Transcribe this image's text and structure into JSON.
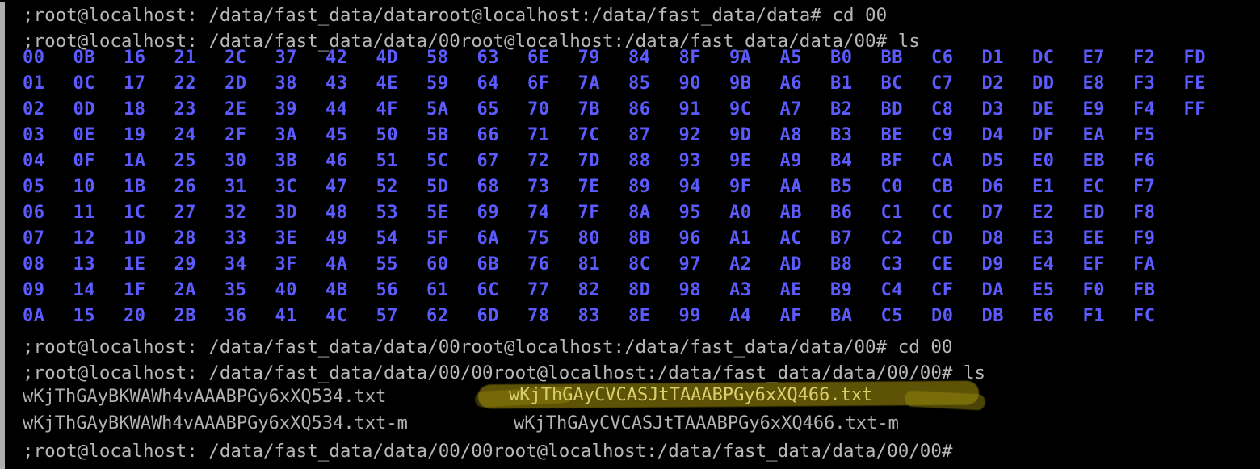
{
  "terminal": {
    "title": "root@localhost terminal",
    "colors": {
      "background": "#000000",
      "foreground": "#b2b2b2",
      "directory_blue": "#5b5bff",
      "highlight_olive": "#aa960a",
      "highlight_text": "#d9cf6e",
      "window_edge": "#aeaeae"
    },
    "lines": [
      {
        "id": "line-1",
        "type": "prompt",
        "text": ";root@localhost: /data/fast_data/dataroot@localhost:/data/fast_data/data# cd 00"
      },
      {
        "id": "line-2",
        "type": "prompt",
        "text": ";root@localhost: /data/fast_data/data/00root@localhost:/data/fast_data/data/00# ls"
      },
      {
        "id": "line-3",
        "type": "prompt",
        "text": ";root@localhost: /data/fast_data/data/00root@localhost:/data/fast_data/data/00# cd 00"
      },
      {
        "id": "line-4",
        "type": "prompt",
        "text": ";root@localhost: /data/fast_data/data/00/00root@localhost:/data/fast_data/data/00/00# ls"
      },
      {
        "id": "line-5",
        "type": "prompt",
        "text": ";root@localhost: /data/fast_data/data/00/00root@localhost:/data/fast_data/data/00/00#"
      }
    ],
    "hex_listing": {
      "description": "ls output of hex-named directories, column-major, 11 rows x 24 columns",
      "rows": 11,
      "columns": 24,
      "entries": [
        "00",
        "01",
        "02",
        "03",
        "04",
        "05",
        "06",
        "07",
        "08",
        "09",
        "0A",
        "0B",
        "0C",
        "0D",
        "0E",
        "0F",
        "10",
        "11",
        "12",
        "13",
        "14",
        "15",
        "16",
        "17",
        "18",
        "19",
        "1A",
        "1B",
        "1C",
        "1D",
        "1E",
        "1F",
        "20",
        "21",
        "22",
        "23",
        "24",
        "25",
        "26",
        "27",
        "28",
        "29",
        "2A",
        "2B",
        "2C",
        "2D",
        "2E",
        "2F",
        "30",
        "31",
        "32",
        "33",
        "34",
        "35",
        "36",
        "37",
        "38",
        "39",
        "3A",
        "3B",
        "3C",
        "3D",
        "3E",
        "3F",
        "40",
        "41",
        "42",
        "43",
        "44",
        "45",
        "46",
        "47",
        "48",
        "49",
        "4A",
        "4B",
        "4C",
        "4D",
        "4E",
        "4F",
        "50",
        "51",
        "52",
        "53",
        "54",
        "55",
        "56",
        "57",
        "58",
        "59",
        "5A",
        "5B",
        "5C",
        "5D",
        "5E",
        "5F",
        "60",
        "61",
        "62",
        "63",
        "64",
        "65",
        "66",
        "67",
        "68",
        "69",
        "6A",
        "6B",
        "6C",
        "6D",
        "6E",
        "6F",
        "70",
        "71",
        "72",
        "73",
        "74",
        "75",
        "76",
        "77",
        "78",
        "79",
        "7A",
        "7B",
        "7C",
        "7D",
        "7E",
        "7F",
        "80",
        "81",
        "82",
        "83",
        "84",
        "85",
        "86",
        "87",
        "88",
        "89",
        "8A",
        "8B",
        "8C",
        "8D",
        "8E",
        "8F",
        "90",
        "91",
        "92",
        "93",
        "94",
        "95",
        "96",
        "97",
        "98",
        "99",
        "9A",
        "9B",
        "9C",
        "9D",
        "9E",
        "9F",
        "A0",
        "A1",
        "A2",
        "A3",
        "A4",
        "A5",
        "A6",
        "A7",
        "A8",
        "A9",
        "AA",
        "AB",
        "AC",
        "AD",
        "AE",
        "AF",
        "B0",
        "B1",
        "B2",
        "B3",
        "B4",
        "B5",
        "B6",
        "B7",
        "B8",
        "B9",
        "BA",
        "BB",
        "BC",
        "BD",
        "BE",
        "BF",
        "C0",
        "C1",
        "C2",
        "C3",
        "C4",
        "C5",
        "C6",
        "C7",
        "C8",
        "C9",
        "CA",
        "CB",
        "CC",
        "CD",
        "CE",
        "CF",
        "D0",
        "D1",
        "D2",
        "D3",
        "D4",
        "D5",
        "D6",
        "D7",
        "D8",
        "D9",
        "DA",
        "DB",
        "DC",
        "DD",
        "DE",
        "DF",
        "E0",
        "E1",
        "E2",
        "E3",
        "E4",
        "E5",
        "E6",
        "E7",
        "E8",
        "E9",
        "EA",
        "EB",
        "EC",
        "ED",
        "EE",
        "EF",
        "F0",
        "F1",
        "F2",
        "F3",
        "F4",
        "F5",
        "F6",
        "F7",
        "F8",
        "F9",
        "FA",
        "FB",
        "FC",
        "FD",
        "FE",
        "FF"
      ]
    },
    "file_listing": {
      "row1": {
        "left": "wKjThGAyBKWAWh4vAAABPGy6xXQ534.txt",
        "right": "wKjThGAyCVCASJtTAAABPGy6xXQ466.txt",
        "right_highlighted": true
      },
      "row2": {
        "left": "wKjThGAyBKWAWh4vAAABPGy6xXQ534.txt-m",
        "right": "wKjThGAyCVCASJtTAAABPGy6xXQ466.txt-m",
        "right_highlighted": false
      }
    },
    "annotation": {
      "type": "highlighter-stroke",
      "target": "wKjThGAyCVCASJtTAAABPGy6xXQ466.txt",
      "color": "#aa960a"
    }
  }
}
